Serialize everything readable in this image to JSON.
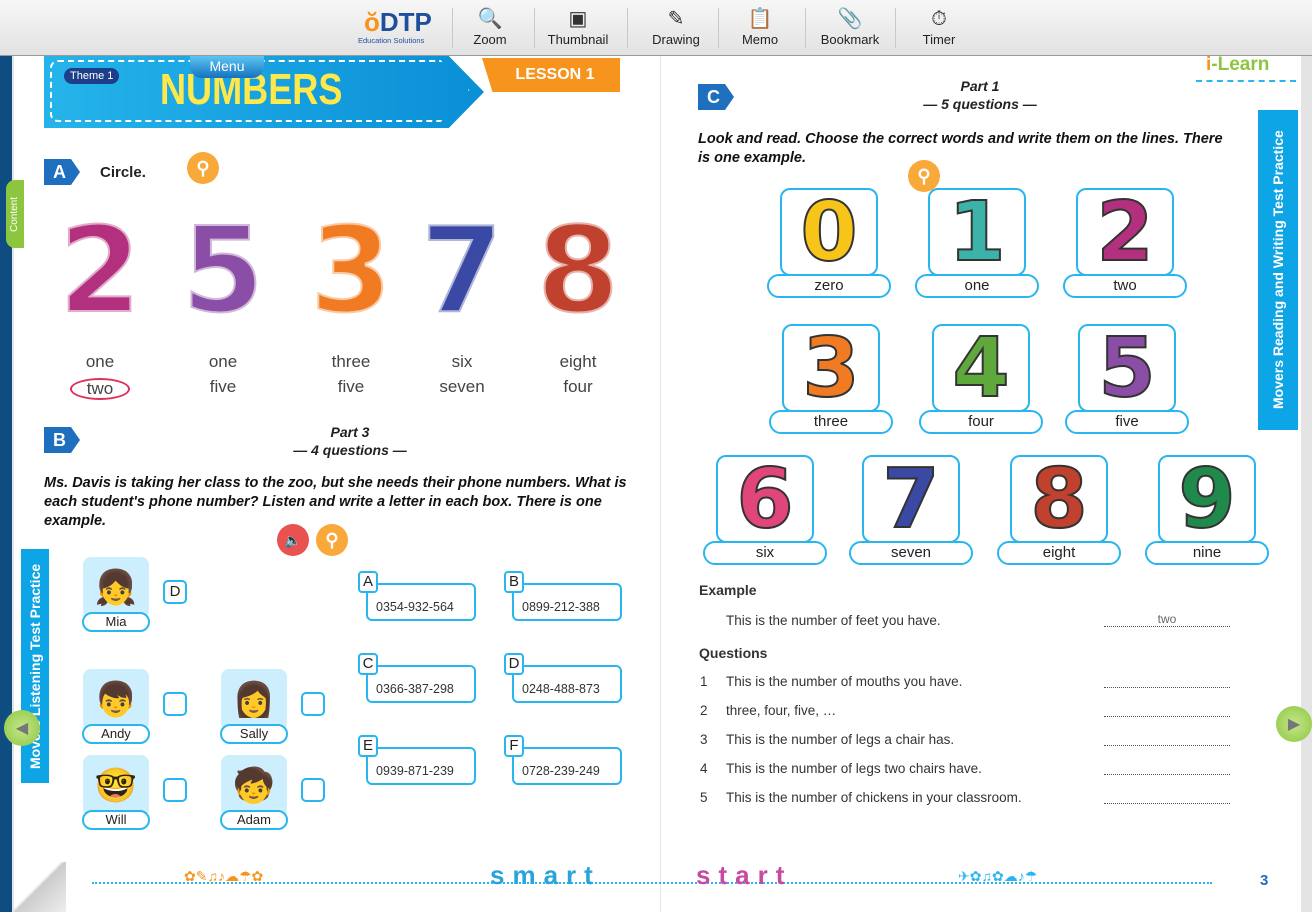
{
  "toolbar": {
    "logo": "DTP",
    "logo_sub": "Education Solutions",
    "tools": [
      {
        "label": "Zoom",
        "icon": "magnifier-icon",
        "glyph": "🔍"
      },
      {
        "label": "Thumbnail",
        "icon": "thumbnail-icon",
        "glyph": "▣"
      },
      {
        "label": "Drawing",
        "icon": "pencil-icon",
        "glyph": "✎"
      },
      {
        "label": "Memo",
        "icon": "memo-icon",
        "glyph": "📋"
      },
      {
        "label": "Bookmark",
        "icon": "paperclip-icon",
        "glyph": "📎"
      },
      {
        "label": "Timer",
        "icon": "stopwatch-icon",
        "glyph": "⏱"
      }
    ]
  },
  "left": {
    "theme": "Theme 1",
    "menu": "Menu",
    "title": "NUMBERS",
    "lesson": "LESSON 1",
    "side_tab": "Content",
    "a": {
      "badge": "A",
      "instruction": "Circle.",
      "numbers": [
        {
          "digit": "2",
          "color": "#b3307e",
          "options": [
            "one",
            "two"
          ],
          "circled": "two"
        },
        {
          "digit": "5",
          "color": "#8b4ea6",
          "options": [
            "one",
            "five"
          ]
        },
        {
          "digit": "3",
          "color": "#f07b22",
          "options": [
            "three",
            "five"
          ]
        },
        {
          "digit": "7",
          "color": "#3a49a3",
          "options": [
            "six",
            "seven"
          ]
        },
        {
          "digit": "8",
          "color": "#c0412e",
          "options": [
            "eight",
            "four"
          ]
        }
      ]
    },
    "b": {
      "badge": "B",
      "part": "Part 3",
      "questions": "— 4 questions —",
      "instruction": "Ms. Davis is taking her class to the zoo, but she needs their phone numbers. What is each student's phone number? Listen and write a letter in each box. There is one example.",
      "vertical_tab": "Movers Listening Test Practice",
      "kids": [
        {
          "name": "Mia",
          "answer": "D"
        },
        {
          "name": "Andy",
          "answer": ""
        },
        {
          "name": "Sally",
          "answer": ""
        },
        {
          "name": "Will",
          "answer": ""
        },
        {
          "name": "Adam",
          "answer": ""
        }
      ],
      "phones": [
        {
          "letter": "A",
          "number": "0354-932-564"
        },
        {
          "letter": "B",
          "number": "0899-212-388"
        },
        {
          "letter": "C",
          "number": "0366-387-298"
        },
        {
          "letter": "D",
          "number": "0248-488-873"
        },
        {
          "letter": "E",
          "number": "0939-871-239"
        },
        {
          "letter": "F",
          "number": "0728-239-249"
        }
      ]
    }
  },
  "right": {
    "brand": "i-Learn",
    "badge": "C",
    "part": "Part 1",
    "questions": "— 5 questions —",
    "instruction": "Look and read. Choose the correct words and write them on the lines. There is one example.",
    "vertical_tab": "Movers Reading and Writing Test Practice",
    "cards": [
      {
        "digit": "0",
        "word": "zero",
        "color": "#f7c41a"
      },
      {
        "digit": "1",
        "word": "one",
        "color": "#3bb3a8"
      },
      {
        "digit": "2",
        "word": "two",
        "color": "#b3307e"
      },
      {
        "digit": "3",
        "word": "three",
        "color": "#f07b22"
      },
      {
        "digit": "4",
        "word": "four",
        "color": "#5fa83c"
      },
      {
        "digit": "5",
        "word": "five",
        "color": "#8b4ea6"
      },
      {
        "digit": "6",
        "word": "six",
        "color": "#e0457b"
      },
      {
        "digit": "7",
        "word": "seven",
        "color": "#3a49a3"
      },
      {
        "digit": "8",
        "word": "eight",
        "color": "#c0412e"
      },
      {
        "digit": "9",
        "word": "nine",
        "color": "#1f8a4c"
      }
    ],
    "example_label": "Example",
    "example": {
      "text": "This is the number of feet you have.",
      "answer": "two"
    },
    "questions_label": "Questions",
    "items": [
      {
        "n": "1",
        "text": "This is the number of mouths you have."
      },
      {
        "n": "2",
        "text": "three, four, five, …"
      },
      {
        "n": "3",
        "text": "This is the number of legs a chair has."
      },
      {
        "n": "4",
        "text": "This is the number of legs two chairs have."
      },
      {
        "n": "5",
        "text": "This is the number of chickens in your classroom."
      }
    ]
  },
  "footer": {
    "word1": "smart",
    "word2": "start",
    "page": "3"
  },
  "colors": {
    "accent": "#29b6f0",
    "banner": "#0a8fd6",
    "lesson": "#f7941d",
    "key": "#f9a93a"
  }
}
